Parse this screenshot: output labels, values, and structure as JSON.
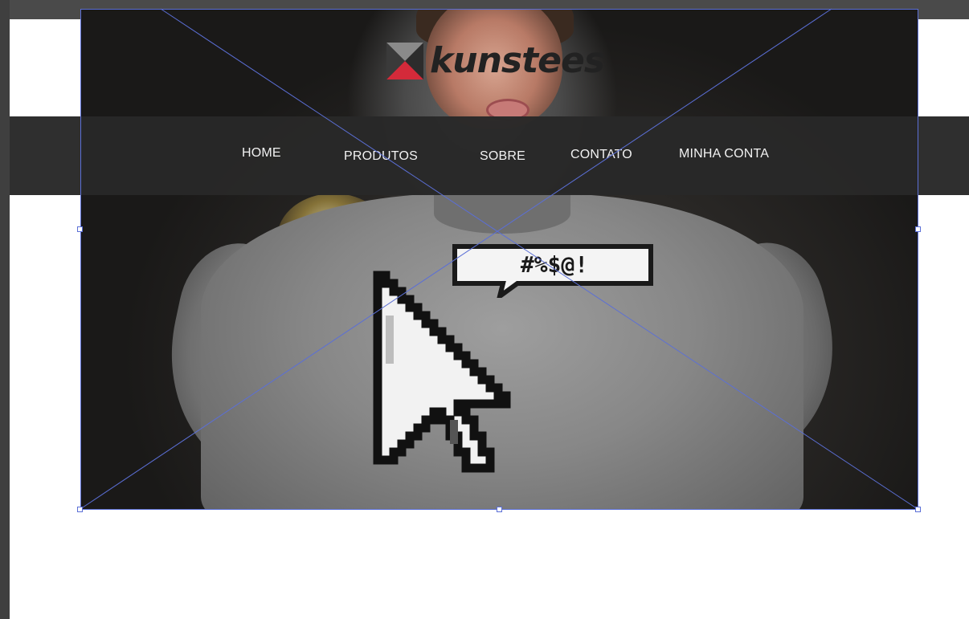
{
  "logo": {
    "text": "kunstees",
    "mark_colors": [
      "#2c2c2c",
      "#d42a3a",
      "#8a8a8a"
    ]
  },
  "nav": {
    "items": [
      {
        "label": "HOME"
      },
      {
        "label": "PRODUTOS"
      },
      {
        "label": "SOBRE"
      },
      {
        "label": "CONTATO"
      },
      {
        "label": "MINHA CONTA"
      }
    ]
  },
  "shirt_graphic": {
    "speech_text": "#%$@!"
  },
  "colors": {
    "navbar": "#282828",
    "placeholder_lines": "#5b6fd6",
    "nav_text": "#f2f2f2"
  }
}
